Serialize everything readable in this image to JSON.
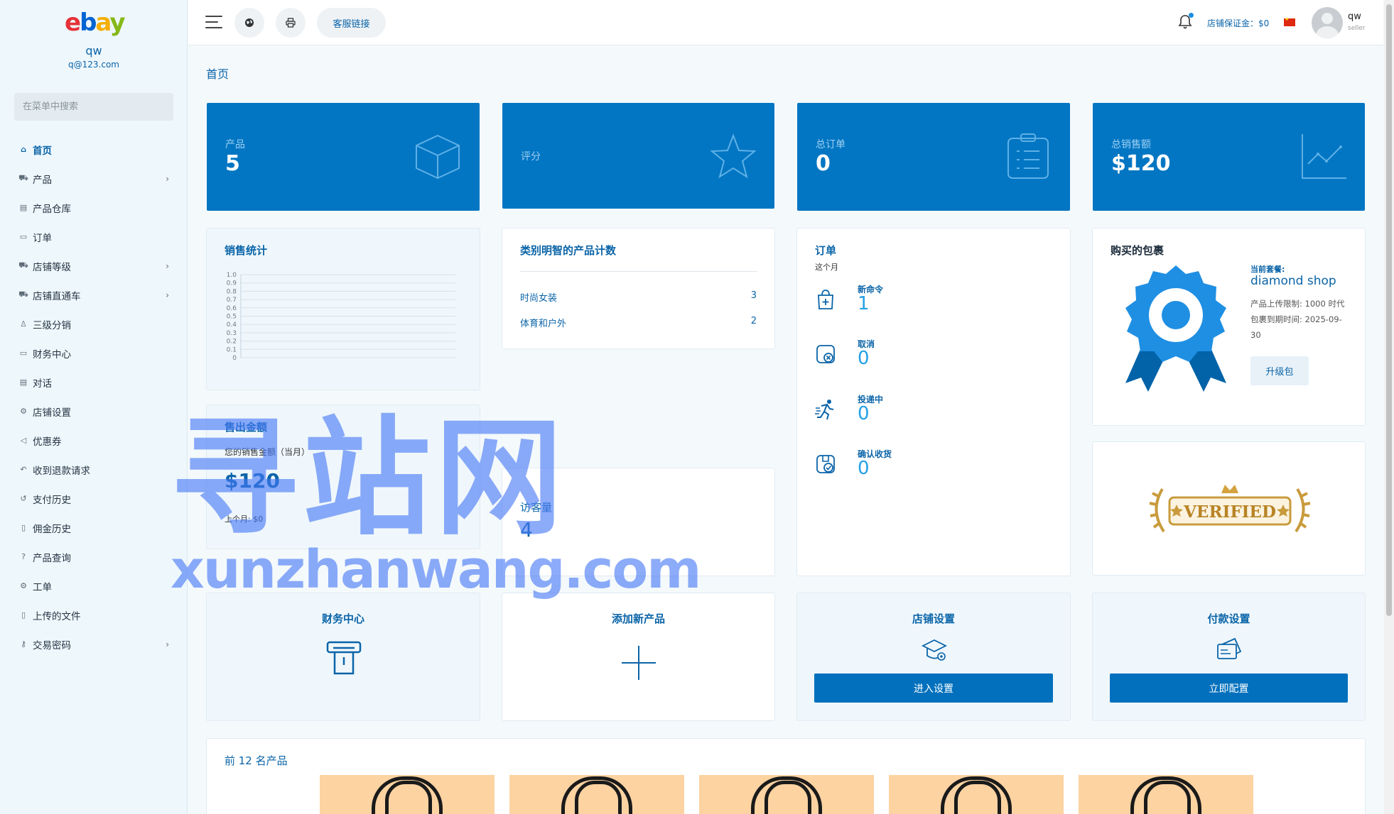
{
  "sidebar": {
    "logo": [
      "e",
      "b",
      "a",
      "y"
    ],
    "user_name": "qw",
    "user_email": "q@123.com",
    "search_placeholder": "在菜单中搜索",
    "items": [
      {
        "label": "首页",
        "icon": "home-icon",
        "active": true
      },
      {
        "label": "产品",
        "icon": "cart-icon",
        "chevron": true
      },
      {
        "label": "产品仓库",
        "icon": "warehouse-icon"
      },
      {
        "label": "订单",
        "icon": "order-icon"
      },
      {
        "label": "店铺等级",
        "icon": "cart-icon",
        "chevron": true
      },
      {
        "label": "店铺直通车",
        "icon": "cart-icon",
        "chevron": true
      },
      {
        "label": "三级分销",
        "icon": "user-icon"
      },
      {
        "label": "财务中心",
        "icon": "money-icon"
      },
      {
        "label": "对话",
        "icon": "chat-icon"
      },
      {
        "label": "店铺设置",
        "icon": "gear-icon"
      },
      {
        "label": "优惠券",
        "icon": "megaphone-icon"
      },
      {
        "label": "收到退款请求",
        "icon": "reply-icon"
      },
      {
        "label": "支付历史",
        "icon": "history-icon"
      },
      {
        "label": "佣金历史",
        "icon": "file-icon"
      },
      {
        "label": "产品查询",
        "icon": "question-icon"
      },
      {
        "label": "工单",
        "icon": "gear-icon"
      },
      {
        "label": "上传的文件",
        "icon": "file-icon"
      },
      {
        "label": "交易密码",
        "icon": "key-icon",
        "chevron": true
      }
    ]
  },
  "header": {
    "support_link": "客服链接",
    "deposit": "店铺保证金：$0",
    "user_name": "qw",
    "user_role": "seller"
  },
  "page": {
    "title": "首页"
  },
  "stats": [
    {
      "label": "产品",
      "value": "5",
      "icon": "box-icon"
    },
    {
      "label": "评分",
      "value": "",
      "icon": "star-icon"
    },
    {
      "label": "总订单",
      "value": "0",
      "icon": "clipboard-icon"
    },
    {
      "label": "总销售额",
      "value": "$120",
      "icon": "trend-icon"
    }
  ],
  "sales_stats": {
    "title": "销售统计",
    "chart_data": {
      "type": "line",
      "title": "",
      "series": [],
      "yticks": [
        "1.0",
        "0.9",
        "0.8",
        "0.7",
        "0.6",
        "0.5",
        "0.4",
        "0.3",
        "0.2",
        "0.1",
        "0"
      ],
      "ylim": [
        0,
        1
      ],
      "grid": true
    }
  },
  "categories": {
    "title": "类别明智的产品计数",
    "rows": [
      {
        "name": "时尚女装",
        "count": "3"
      },
      {
        "name": "体育和户外",
        "count": "2"
      }
    ]
  },
  "orders": {
    "title": "订单",
    "subtitle": "这个月",
    "rows": [
      {
        "label": "新命令",
        "value": "1",
        "icon": "bag-plus-icon"
      },
      {
        "label": "取消",
        "value": "0",
        "icon": "cancel-icon"
      },
      {
        "label": "投递中",
        "value": "0",
        "icon": "runner-icon"
      },
      {
        "label": "确认收货",
        "value": "0",
        "icon": "check-box-icon"
      }
    ]
  },
  "package": {
    "title": "购买的包裹",
    "current_label": "当前套餐:",
    "name": "diamond shop",
    "upload_limit": "产品上传限制: 1000 时代",
    "expiry": "包裹到期时间: 2025-09-30",
    "upgrade": "升级包"
  },
  "verified": {
    "text": "VERIFIED"
  },
  "sales_amount": {
    "title": "售出金额",
    "subtitle": "您的销售金额（当月）",
    "value": "$120",
    "last_month": "上个月: $0"
  },
  "visitors": {
    "label": "访客量",
    "value": "4"
  },
  "actions": [
    {
      "title": "财务中心",
      "icon": "finance-icon"
    },
    {
      "title": "添加新产品",
      "icon": "plus-icon"
    },
    {
      "title": "店铺设置",
      "icon": "shop-settings-icon",
      "button": "进入设置"
    },
    {
      "title": "付款设置",
      "icon": "card-icon",
      "button": "立即配置"
    }
  ],
  "top_products": {
    "title": "前 12 名产品",
    "count": 5
  },
  "watermark": {
    "cn": "寻站网",
    "en": "xunzhanwang.com"
  },
  "colors": {
    "primary": "#0276c3",
    "accent": "#0a64a8",
    "light": "#eff7fc"
  }
}
